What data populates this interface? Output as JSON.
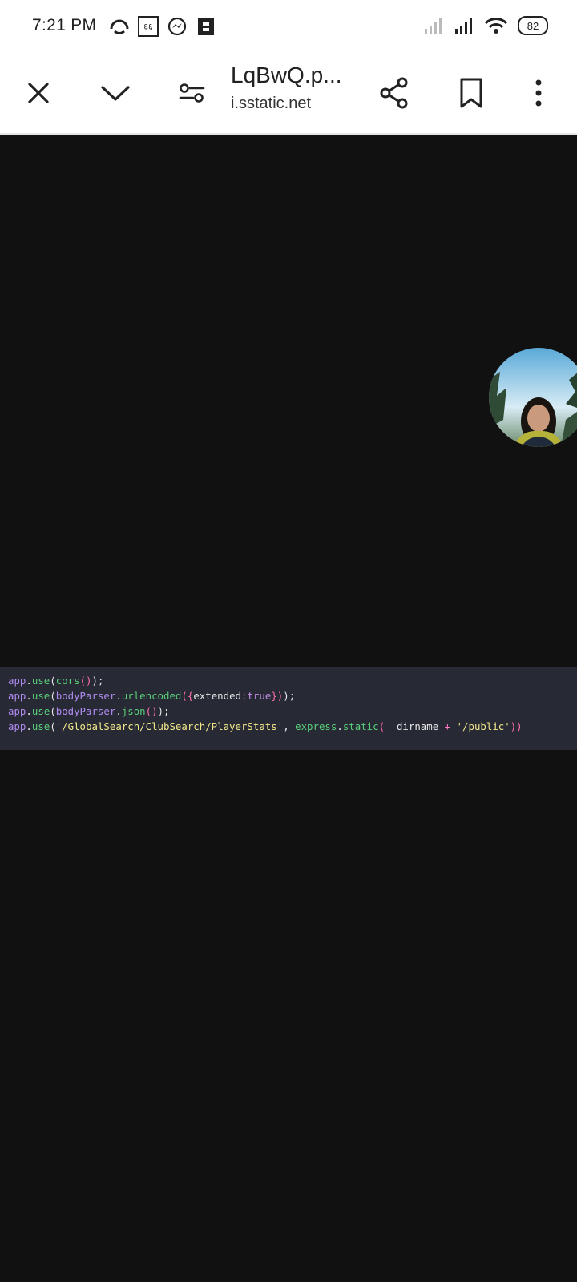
{
  "status_bar": {
    "time": "7:21 PM",
    "notification_icons": [
      "sync-arc-icon",
      "translate-icon",
      "messenger-icon",
      "sim-card-icon"
    ],
    "indicator_text": "६६",
    "battery_level": "82"
  },
  "toolbar": {
    "title": "LqBwQ.p...",
    "domain": "i.sstatic.net"
  },
  "code": {
    "lines": [
      [
        {
          "t": "app",
          "c": "t-app"
        },
        {
          "t": ".",
          "c": "t-pn"
        },
        {
          "t": "use",
          "c": "t-fn"
        },
        {
          "t": "(",
          "c": "t-pn"
        },
        {
          "t": "cors",
          "c": "t-fn"
        },
        {
          "t": "()",
          "c": "t-br"
        },
        {
          "t": ");",
          "c": "t-pn"
        }
      ],
      [
        {
          "t": "app",
          "c": "t-app"
        },
        {
          "t": ".",
          "c": "t-pn"
        },
        {
          "t": "use",
          "c": "t-fn"
        },
        {
          "t": "(",
          "c": "t-pn"
        },
        {
          "t": "bodyParser",
          "c": "t-app"
        },
        {
          "t": ".",
          "c": "t-pn"
        },
        {
          "t": "urlencoded",
          "c": "t-fn"
        },
        {
          "t": "({",
          "c": "t-br"
        },
        {
          "t": "extended",
          "c": "t-pn"
        },
        {
          "t": ":",
          "c": "t-op"
        },
        {
          "t": "true",
          "c": "t-kw"
        },
        {
          "t": "})",
          "c": "t-br"
        },
        {
          "t": ");",
          "c": "t-pn"
        }
      ],
      [
        {
          "t": "app",
          "c": "t-app"
        },
        {
          "t": ".",
          "c": "t-pn"
        },
        {
          "t": "use",
          "c": "t-fn"
        },
        {
          "t": "(",
          "c": "t-pn"
        },
        {
          "t": "bodyParser",
          "c": "t-app"
        },
        {
          "t": ".",
          "c": "t-pn"
        },
        {
          "t": "json",
          "c": "t-fn"
        },
        {
          "t": "()",
          "c": "t-br"
        },
        {
          "t": ");",
          "c": "t-pn"
        }
      ],
      [
        {
          "t": "app",
          "c": "t-app"
        },
        {
          "t": ".",
          "c": "t-pn"
        },
        {
          "t": "use",
          "c": "t-fn"
        },
        {
          "t": "(",
          "c": "t-pn"
        },
        {
          "t": "'/GlobalSearch/ClubSearch/PlayerStats'",
          "c": "t-str"
        },
        {
          "t": ", ",
          "c": "t-pn"
        },
        {
          "t": "express",
          "c": "t-fn"
        },
        {
          "t": ".",
          "c": "t-pn"
        },
        {
          "t": "static",
          "c": "t-fn"
        },
        {
          "t": "(",
          "c": "t-br"
        },
        {
          "t": "__dirname",
          "c": "t-pn"
        },
        {
          "t": " + ",
          "c": "t-op"
        },
        {
          "t": "'/public'",
          "c": "t-str"
        },
        {
          "t": "))",
          "c": "t-br"
        }
      ]
    ]
  },
  "colors": {
    "viewer_background": "#111111",
    "code_background": "#272935",
    "toolbar_background": "#ffffff"
  }
}
